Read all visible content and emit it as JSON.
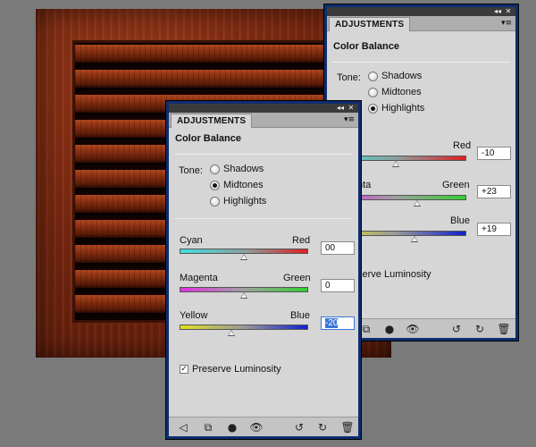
{
  "panels": {
    "back": {
      "tab": "ADJUSTMENTS",
      "title": "Color Balance",
      "tone_label": "Tone:",
      "tones": [
        "Shadows",
        "Midtones",
        "Highlights"
      ],
      "selected_tone": "Highlights",
      "sliders": [
        {
          "left": "",
          "right": "Red",
          "value": "-10",
          "level": -10
        },
        {
          "left": "nta",
          "right": "Green",
          "value": "+23",
          "level": 23
        },
        {
          "left": "",
          "right": "Blue",
          "value": "+19",
          "level": 19
        }
      ],
      "checkbox_label": "serve Luminosity"
    },
    "front": {
      "tab": "ADJUSTMENTS",
      "title": "Color Balance",
      "tone_label": "Tone:",
      "tones": [
        "Shadows",
        "Midtones",
        "Highlights"
      ],
      "selected_tone": "Midtones",
      "sliders": [
        {
          "left": "Cyan",
          "right": "Red",
          "value": "00",
          "level": 0
        },
        {
          "left": "Magenta",
          "right": "Green",
          "value": "0",
          "level": 0
        },
        {
          "left": "Yellow",
          "right": "Blue",
          "value": "-20",
          "level": -20
        }
      ],
      "checkbox_label": "Preserve Luminosity",
      "preserve_luminosity": true
    }
  },
  "icons": {
    "titlebar": [
      "collapse-icon",
      "close-icon",
      "panel-menu-icon"
    ],
    "footer": [
      "back-arrow-icon",
      "expand-view-icon",
      "clip-layer-icon",
      "visibility-eye-icon",
      "view-previous-icon",
      "reset-icon",
      "delete-icon"
    ]
  },
  "colors": {
    "panel_border": "#0f2d6e",
    "panel_bg": "#d6d6d6",
    "selection": "#3b76d6"
  }
}
